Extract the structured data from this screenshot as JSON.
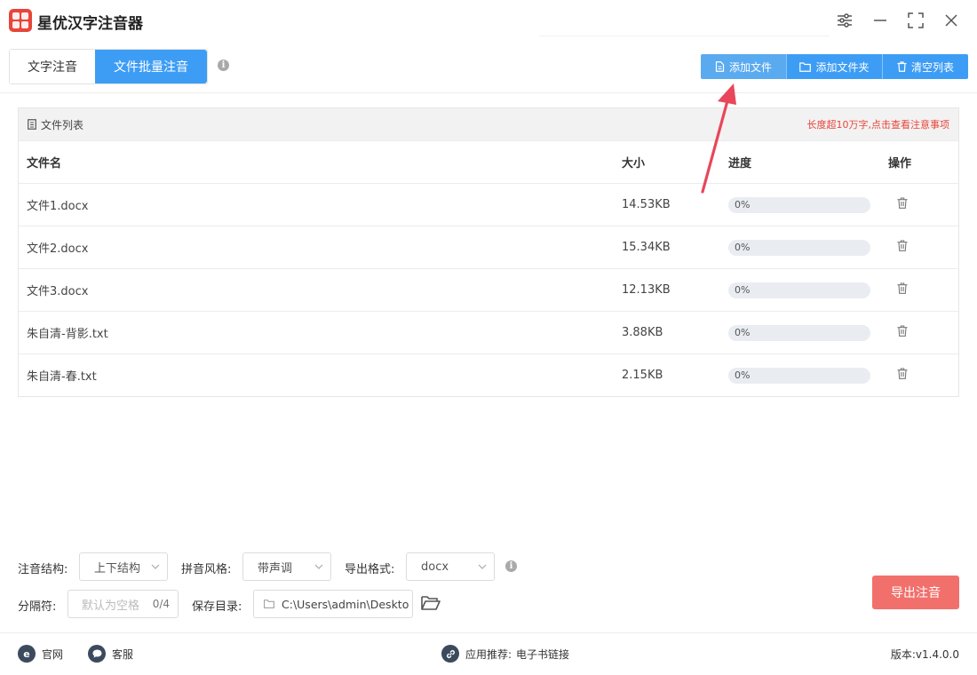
{
  "app": {
    "title": "星优汉字注音器"
  },
  "tabs": [
    {
      "label": "文字注音"
    },
    {
      "label": "文件批量注音"
    }
  ],
  "toolbar": {
    "add_file": "添加文件",
    "add_folder": "添加文件夹",
    "clear_list": "清空列表"
  },
  "filelist": {
    "title": "文件列表",
    "notice": "长度超10万字,点击查看注意事项",
    "columns": {
      "name": "文件名",
      "size": "大小",
      "progress": "进度",
      "action": "操作"
    },
    "rows": [
      {
        "name": "文件1.docx",
        "size": "14.53KB",
        "progress_label": "0%",
        "progress": 0
      },
      {
        "name": "文件2.docx",
        "size": "15.34KB",
        "progress_label": "0%",
        "progress": 0
      },
      {
        "name": "文件3.docx",
        "size": "12.13KB",
        "progress_label": "0%",
        "progress": 0
      },
      {
        "name": "朱自清-背影.txt",
        "size": "3.88KB",
        "progress_label": "0%",
        "progress": 0
      },
      {
        "name": "朱自清-春.txt",
        "size": "2.15KB",
        "progress_label": "0%",
        "progress": 0
      }
    ]
  },
  "settings": {
    "structure_label": "注音结构:",
    "structure_value": "上下结构",
    "style_label": "拼音风格:",
    "style_value": "带声调",
    "format_label": "导出格式:",
    "format_value": "docx",
    "separator_label": "分隔符:",
    "separator_placeholder": "默认为空格",
    "separator_count": "0/4",
    "savedir_label": "保存目录:",
    "savedir_value": "C:\\Users\\admin\\Deskto"
  },
  "export_button": "导出注音",
  "footer": {
    "website": "官网",
    "support": "客服",
    "recommend_label": "应用推荐:",
    "recommend_link": "电子书链接",
    "version": "版本:v1.4.0.0"
  },
  "colors": {
    "primary": "#3d9df5",
    "danger": "#e8463b",
    "export": "#f2706b",
    "arrow": "#e8465a"
  },
  "icons": [
    "settings-sliders-icon",
    "minimize-icon",
    "maximize-icon",
    "close-icon",
    "info-icon",
    "file-icon",
    "folder-icon",
    "trash-icon",
    "list-icon",
    "folder-open-icon",
    "ie-icon",
    "chat-icon",
    "link-icon"
  ]
}
